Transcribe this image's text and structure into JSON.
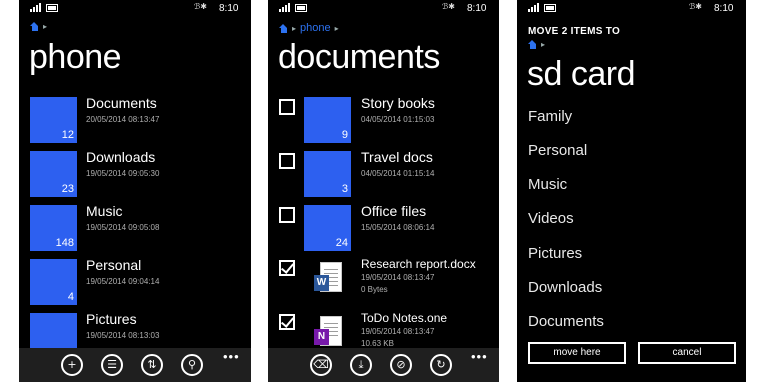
{
  "status": {
    "time": "8:10",
    "bt": "ℬ✱"
  },
  "screen1": {
    "breadcrumb": [],
    "title": "phone",
    "items": [
      {
        "name": "Documents",
        "date": "20/05/2014 08:13:47",
        "count": "12"
      },
      {
        "name": "Downloads",
        "date": "19/05/2014 09:05:30",
        "count": "23"
      },
      {
        "name": "Music",
        "date": "19/05/2014 09:05:08",
        "count": "148"
      },
      {
        "name": "Personal",
        "date": "19/05/2014 09:04:14",
        "count": "4"
      },
      {
        "name": "Pictures",
        "date": "19/05/2014 08:13:03",
        "count": ""
      }
    ],
    "appbar": {
      "icons": [
        "new-folder-icon",
        "select-icon",
        "sort-icon",
        "search-icon"
      ],
      "more": "•••"
    }
  },
  "screen2": {
    "breadcrumb": [
      "phone"
    ],
    "title": "documents",
    "items": [
      {
        "name": "Story books",
        "date": "04/05/2014 01:15:03",
        "count": "9",
        "checked": false,
        "kind": "folder"
      },
      {
        "name": "Travel docs",
        "date": "04/05/2014 01:15:14",
        "count": "3",
        "checked": false,
        "kind": "folder"
      },
      {
        "name": "Office files",
        "date": "15/05/2014 08:06:14",
        "count": "24",
        "checked": false,
        "kind": "folder"
      },
      {
        "name": "Research report.docx",
        "date": "19/05/2014 08:13:47",
        "size": "0 Bytes",
        "checked": true,
        "kind": "word",
        "badge": "W",
        "color": "#2b579a"
      },
      {
        "name": "ToDo Notes.one",
        "date": "19/05/2014 08:13:47",
        "size": "10.63 KB",
        "checked": true,
        "kind": "onenote",
        "badge": "N",
        "color": "#7719aa"
      }
    ],
    "appbar": {
      "icons": [
        "delete-icon",
        "download-icon",
        "attach-icon",
        "share-icon"
      ],
      "more": "•••"
    }
  },
  "screen3": {
    "heading": "MOVE 2 ITEMS TO",
    "title": "sd card",
    "destinations": [
      "Family",
      "Personal",
      "Music",
      "Videos",
      "Pictures",
      "Downloads",
      "Documents"
    ],
    "buttons": {
      "move": "move here",
      "cancel": "cancel"
    }
  },
  "colors": {
    "tile": "#2d60f0",
    "accent": "#2d72f0",
    "appbar": "#1f1f1f",
    "background": "#000000"
  }
}
